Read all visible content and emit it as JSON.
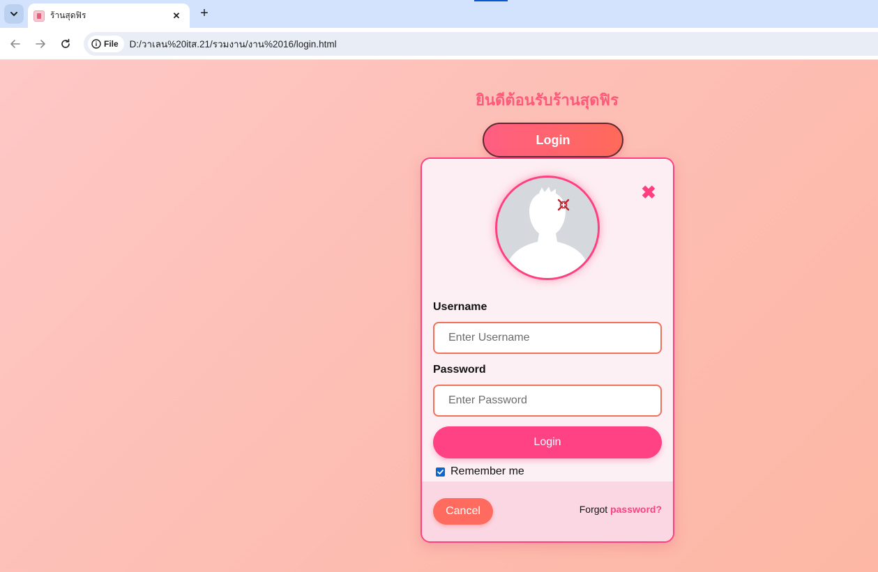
{
  "browser": {
    "tab_title": "ร้านสุดฟิร",
    "tab_close": "✕",
    "new_tab": "+",
    "chip_label": "File",
    "url": "D:/วาเลน%20itส.21/รวมงาน/งาน%2016/login.html"
  },
  "page": {
    "welcome_title": "ยินดีต้อนรับร้านสุดฟิร",
    "open_login_label": "Login"
  },
  "modal": {
    "close_glyph": "✖",
    "username_label": "Username",
    "username_placeholder": "Enter Username",
    "password_label": "Password",
    "password_placeholder": "Enter Password",
    "login_button": "Login",
    "remember_label": "Remember me",
    "remember_checked": true,
    "cancel_button": "Cancel",
    "forgot_prefix": "Forgot",
    "forgot_link": "password?"
  },
  "colors": {
    "accent_pink": "#ff3f7f",
    "coral": "#ff6b5f",
    "page_bg": "#fdbdb2",
    "welcome_text": "#ff5a7a"
  },
  "icons": {
    "back": "arrow-left-icon",
    "forward": "arrow-right-icon",
    "reload": "reload-icon",
    "info": "info-icon",
    "close": "close-icon",
    "avatar": "user-silhouette-icon",
    "anger": "anger-mark-icon"
  }
}
